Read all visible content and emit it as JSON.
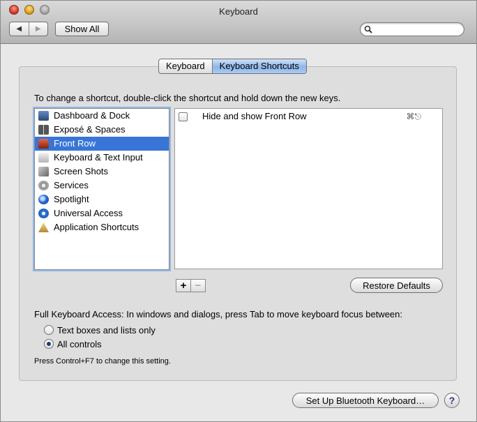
{
  "window": {
    "title": "Keyboard"
  },
  "toolbar": {
    "back_glyph": "◀",
    "forward_glyph": "▶",
    "show_all_label": "Show All",
    "search_placeholder": ""
  },
  "tabs": [
    {
      "label": "Keyboard",
      "active": false
    },
    {
      "label": "Keyboard Shortcuts",
      "active": true
    }
  ],
  "instructions": "To change a shortcut, double-click the shortcut and hold down the new keys.",
  "categories": [
    {
      "label": "Dashboard & Dock",
      "icon": "dock-icon",
      "color": "#3b5a8a"
    },
    {
      "label": "Exposé & Spaces",
      "icon": "spaces-icon",
      "color": "#4a4a4a"
    },
    {
      "label": "Front Row",
      "icon": "front-row-icon",
      "color": "#b83a1a",
      "selected": true
    },
    {
      "label": "Keyboard & Text Input",
      "icon": "keyboard-icon",
      "color": "#bdbdbd"
    },
    {
      "label": "Screen Shots",
      "icon": "screenshot-icon",
      "color": "#8a8a8a"
    },
    {
      "label": "Services",
      "icon": "gear-icon",
      "color": "#9a9a9a"
    },
    {
      "label": "Spotlight",
      "icon": "spotlight-icon",
      "color": "#2a6ad8"
    },
    {
      "label": "Universal Access",
      "icon": "universal-access-icon",
      "color": "#2a7ad8"
    },
    {
      "label": "Application Shortcuts",
      "icon": "app-shortcuts-icon",
      "color": "#c8a048"
    }
  ],
  "shortcuts": [
    {
      "label": "Hide and show Front Row",
      "key": "⌘⎋",
      "checked": false
    }
  ],
  "list_controls": {
    "add": "+",
    "remove": "−"
  },
  "restore_label": "Restore Defaults",
  "full_keyboard_access": {
    "label": "Full Keyboard Access: In windows and dialogs, press Tab to move keyboard focus between:",
    "options": [
      {
        "label": "Text boxes and lists only",
        "selected": false
      },
      {
        "label": "All controls",
        "selected": true
      }
    ],
    "hint": "Press Control+F7 to change this setting."
  },
  "bluetooth_label": "Set Up Bluetooth Keyboard…",
  "help_glyph": "?"
}
